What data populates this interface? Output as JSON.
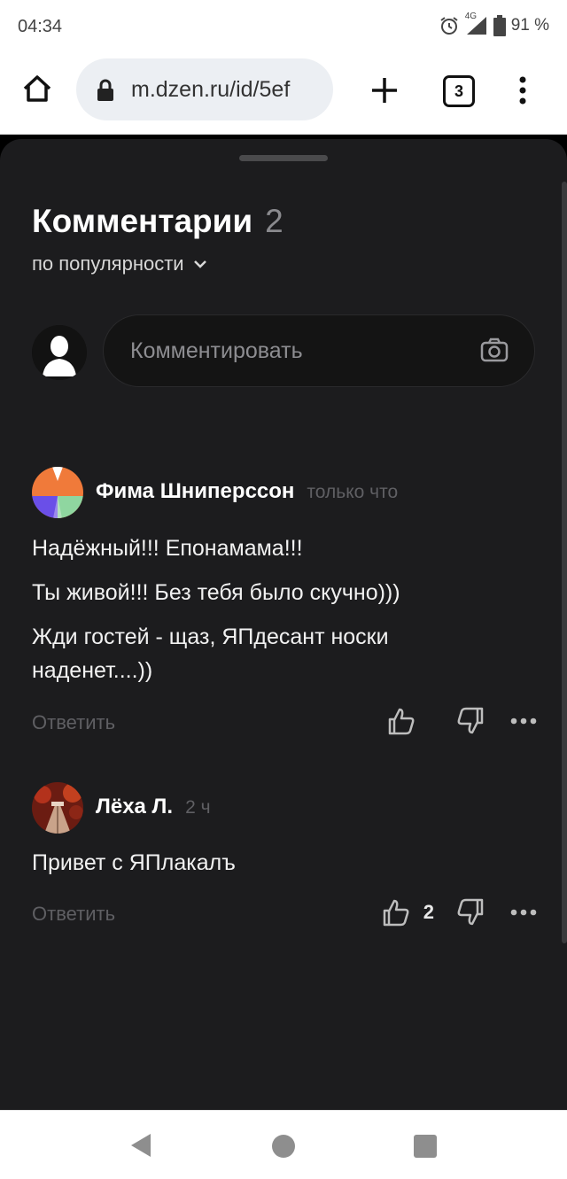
{
  "status": {
    "time": "04:34",
    "network": "4G",
    "battery": "91 %"
  },
  "browser": {
    "url": "m.dzen.ru/id/5ef",
    "tabs_count": "3"
  },
  "comments_panel": {
    "title": "Комментарии",
    "count": "2",
    "sort_label": "по популярности",
    "input_placeholder": "Комментировать"
  },
  "comments": [
    {
      "author": "Фима Шниперссон",
      "time": "только что",
      "lines": [
        "Надёжный!!! Епонамама!!!",
        "Ты живой!!! Без тебя было скучно)))",
        "Жди гостей - щаз, ЯПдесант носки наденет....))"
      ],
      "reply_label": "Ответить",
      "likes": ""
    },
    {
      "author": "Лёха Л.",
      "time": "2 ч",
      "lines": [
        "Привет с ЯПлакалъ"
      ],
      "reply_label": "Ответить",
      "likes": "2"
    }
  ],
  "icons": {
    "alarm": "alarm-icon",
    "signal": "signal-icon",
    "battery": "battery-icon",
    "home": "home-icon",
    "lock": "lock-icon",
    "plus": "plus-icon",
    "menu": "more-vertical-icon",
    "camera": "camera-icon",
    "like": "thumb-up-icon",
    "dislike": "thumb-down-icon",
    "more": "more-horizontal-icon",
    "back": "back-triangle-icon",
    "nav_home": "nav-home-circle-icon",
    "recent": "recent-square-icon"
  },
  "colors": {
    "sheet_bg": "#1c1c1e",
    "avatar1_top": "#f07a3a",
    "avatar1_left": "#6a4fe8",
    "avatar1_right": "#8fd6a0"
  }
}
